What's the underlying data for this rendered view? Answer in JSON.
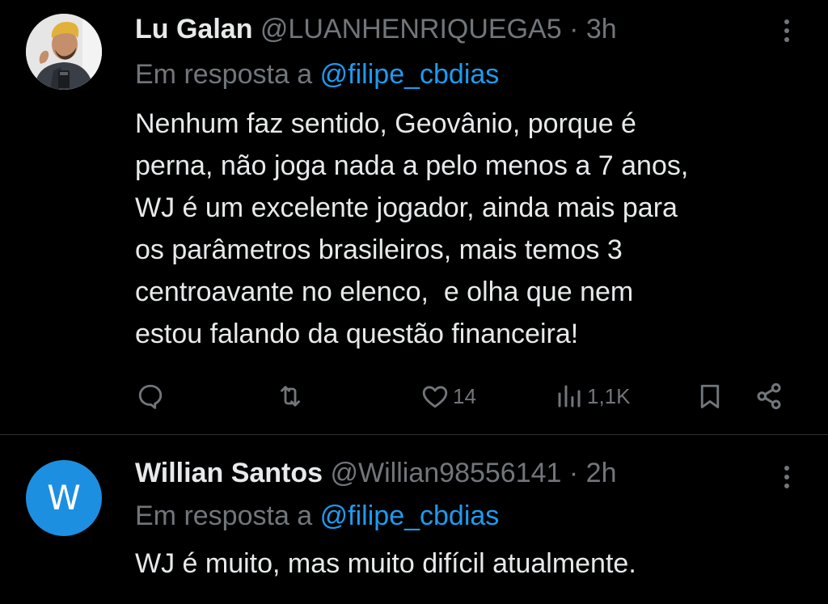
{
  "colors": {
    "background": "#000000",
    "text": "#e7e9ea",
    "secondary": "#71767b",
    "link": "#1d9bf0",
    "avatar_w": "#1d8fe1",
    "divider": "#2f3336"
  },
  "tweets": [
    {
      "name": "Lu Galan",
      "handle": "@LUANHENRIQUEGA5",
      "separator": "·",
      "time": "3h",
      "reply_prefix": "Em resposta a",
      "reply_to": "@filipe_cbdias",
      "avatar_icon": "user-photo-avatar",
      "body_lines": [
        "Nenhum faz sentido, Geovânio, porque é",
        "perna, não joga nada a pelo menos a 7 anos,",
        "WJ é um excelente jogador, ainda mais para",
        "os parâmetros brasileiros, mais temos 3",
        "centroavante no elenco,  e olha que nem",
        "estou falando da questão financeira!"
      ],
      "actions": {
        "reply_icon": "reply-icon",
        "retweet_icon": "retweet-icon",
        "like_icon": "heart-icon",
        "like_count": "14",
        "views_icon": "views-icon",
        "views_count": "1,1K",
        "bookmark_icon": "bookmark-icon",
        "share_icon": "share-icon"
      },
      "more_icon": "more-vertical-icon"
    },
    {
      "name": "Willian Santos",
      "handle": "@Willian98556141",
      "separator": "·",
      "time": "2h",
      "reply_prefix": "Em resposta a",
      "reply_to": "@filipe_cbdias",
      "avatar_letter": "W",
      "body_lines": [
        "WJ é muito, mas muito difícil atualmente."
      ],
      "more_icon": "more-vertical-icon"
    }
  ]
}
